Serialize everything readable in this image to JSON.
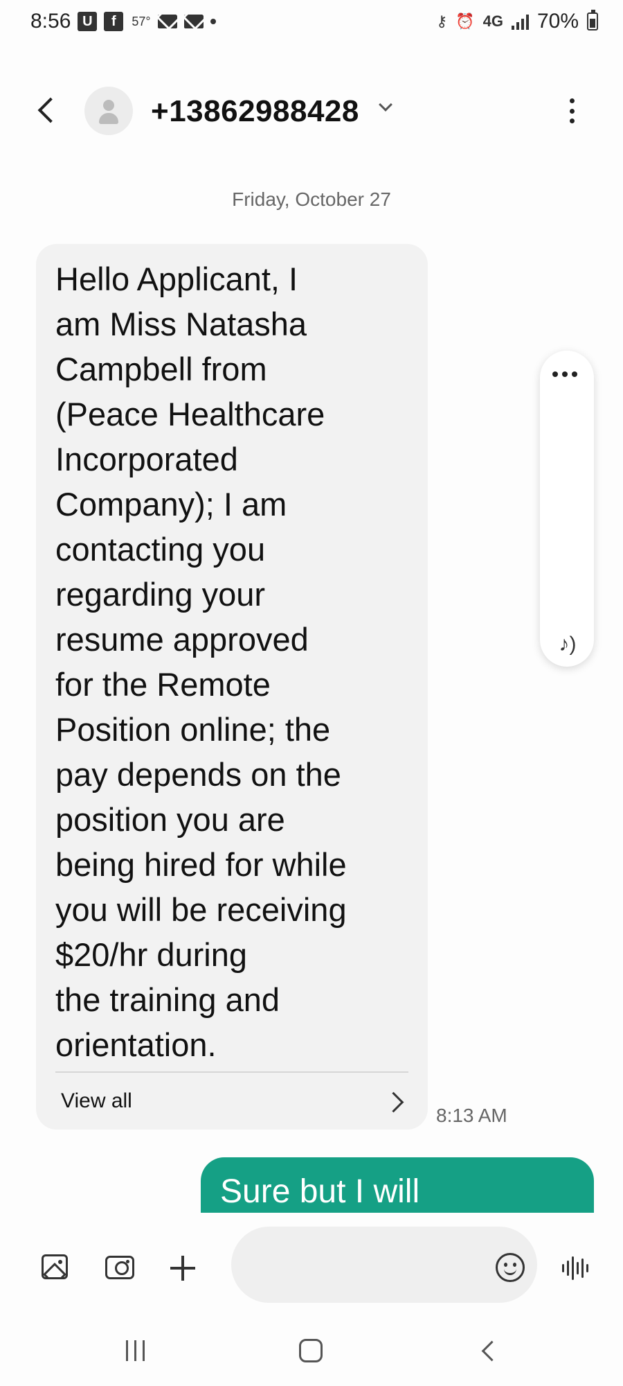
{
  "status_bar": {
    "time": "8:56",
    "app_badge_1": "U",
    "app_badge_2": "f",
    "temperature": "57°",
    "network": "4G",
    "battery": "70%"
  },
  "header": {
    "contact": "+13862988428"
  },
  "conversation": {
    "date": "Friday, October 27",
    "incoming": {
      "text": "Hello Applicant, I\nam Miss Natasha\nCampbell from\n(Peace Healthcare\nIncorporated\nCompany); I am\ncontacting you\nregarding your\nresume approved\nfor the Remote\nPosition online; the\npay depends on the\nposition you are\nbeing hired for while\nyou will be receiving\n$20/hr during\nthe training and\norientation.",
      "view_all": "View all",
      "time": "8:13 AM"
    },
    "outgoing": {
      "text": "Sure but I will"
    }
  },
  "compose": {
    "placeholder": ""
  },
  "colors": {
    "outgoing_bubble": "#15a085",
    "incoming_bubble": "#f2f2f2"
  }
}
